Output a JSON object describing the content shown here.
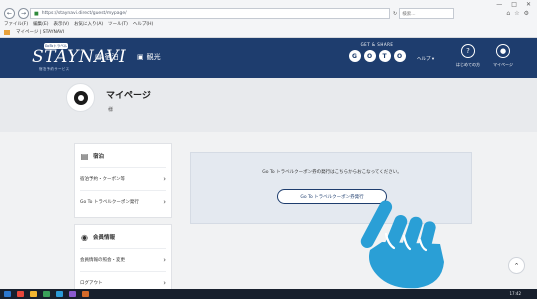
{
  "browser": {
    "url": "https://staynavi.direct/guest/mypage/",
    "search_placeholder": "検索...",
    "menu_items": [
      "ファイル(F)",
      "編集(E)",
      "表示(V)",
      "お気に入り(A)",
      "ツール(T)",
      "ヘルプ(H)"
    ],
    "tab_label": "マイページ | STAYNAVI"
  },
  "site": {
    "logo_badge": "GoToトラベル",
    "logo_text": "STAYNAVI",
    "logo_sub": "宿泊予約サービス",
    "nav": [
      {
        "icon": "calendar-icon",
        "label": "宿泊"
      },
      {
        "icon": "ticket-icon",
        "label": "観光"
      }
    ],
    "gift_label": "GET & SHARE",
    "gift_circles": [
      "G",
      "O",
      "T",
      "O"
    ],
    "help_label": "ヘルプ ▾",
    "header_icons": [
      {
        "icon": "question-icon",
        "label": "はじめての方"
      },
      {
        "icon": "user-icon",
        "label": "マイページ"
      }
    ]
  },
  "page": {
    "title": "マイページ",
    "subtitle": "様"
  },
  "sidebar": {
    "sections": [
      {
        "icon": "lodging-icon",
        "title": "宿泊",
        "items": [
          "宿泊予約・クーポン等",
          "Go To トラベルクーポン発行"
        ]
      },
      {
        "icon": "member-icon",
        "title": "会員情報",
        "items": [
          "会員情報の照会・変更",
          "ログアウト"
        ]
      }
    ]
  },
  "panel": {
    "message": "Go To トラベルクーポン券の発行はこちらからおこなってください。",
    "button_label": "Go To トラベルクーポン券発行"
  },
  "taskbar": {
    "clock": "17:42"
  }
}
